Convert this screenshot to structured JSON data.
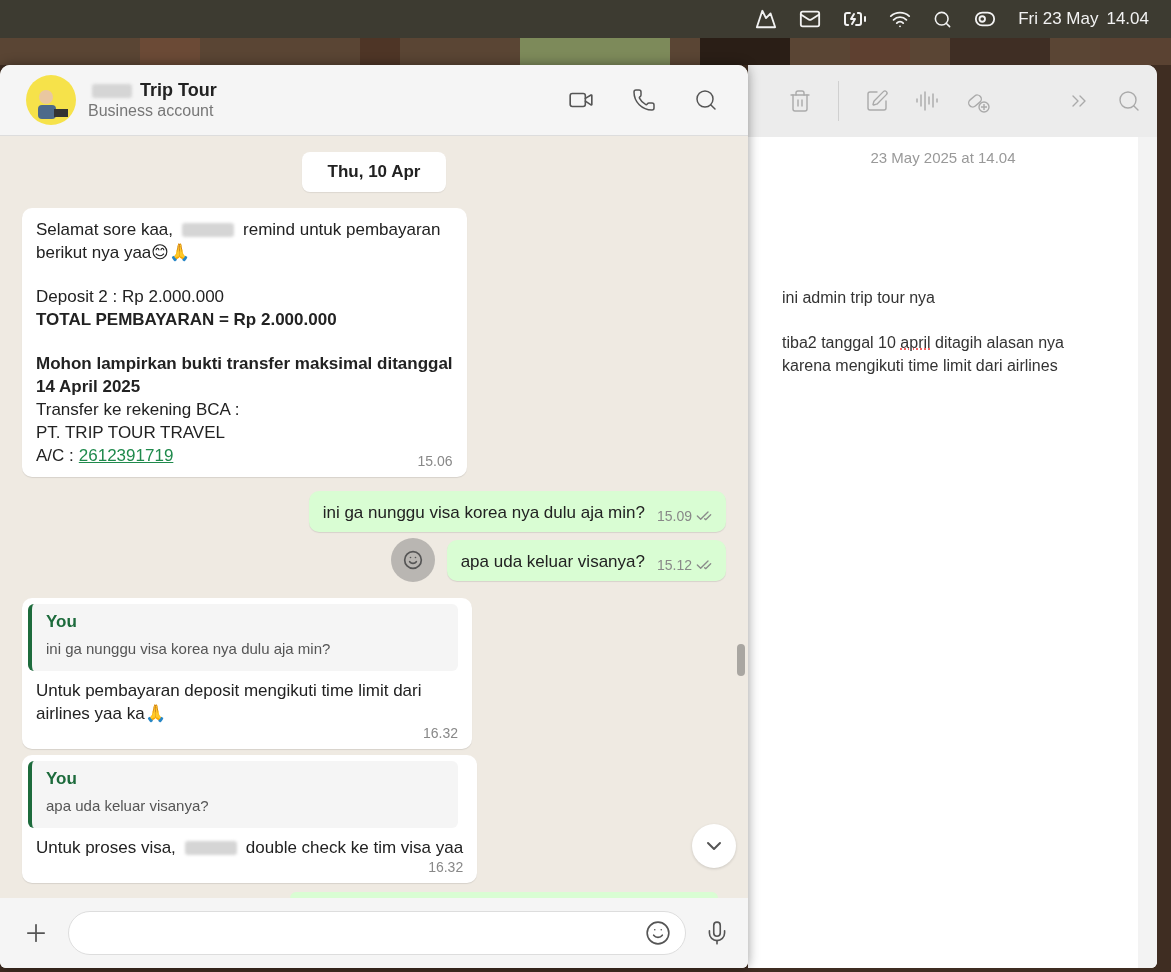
{
  "menu_bar": {
    "date": "Fri 23 May",
    "time": "14.04"
  },
  "chat": {
    "header": {
      "name": "Trip Tour",
      "name_redacted_prefix": true,
      "subtitle": "Business account"
    },
    "date_divider": "Thu, 10 Apr",
    "messages": [
      {
        "outgoing": false,
        "kind": "plain",
        "time": "15.06",
        "paragraphs": [
          [
            {
              "bold": false,
              "parts": [
                {
                  "kind": "text",
                  "text": "Selamat sore kaa,"
                },
                {
                  "kind": "redacted"
                },
                {
                  "kind": "text",
                  "text": "remind untuk pembayaran"
                }
              ]
            },
            {
              "bold": false,
              "parts": [
                {
                  "kind": "text",
                  "text": "berikut nya yaa😊🙏"
                }
              ]
            }
          ],
          [
            {
              "bold": false,
              "parts": [
                {
                  "kind": "text",
                  "text": "Deposit 2 : Rp 2.000.000"
                }
              ]
            },
            {
              "bold": true,
              "parts": [
                {
                  "kind": "text",
                  "text": "TOTAL PEMBAYARAN = Rp 2.000.000"
                }
              ]
            }
          ],
          [
            {
              "bold": true,
              "parts": [
                {
                  "kind": "text",
                  "text": "Mohon lampirkan bukti transfer maksimal ditanggal"
                }
              ]
            },
            {
              "bold": true,
              "parts": [
                {
                  "kind": "text",
                  "text": "14 April 2025"
                }
              ]
            },
            {
              "bold": false,
              "parts": [
                {
                  "kind": "text",
                  "text": "Transfer ke rekening BCA :"
                }
              ]
            },
            {
              "bold": false,
              "parts": [
                {
                  "kind": "text",
                  "text": "PT. TRIP TOUR TRAVEL"
                }
              ]
            },
            {
              "bold": false,
              "parts": [
                {
                  "kind": "text",
                  "text": "A/C :"
                },
                {
                  "kind": "link",
                  "text": "2612391719"
                }
              ]
            }
          ]
        ]
      },
      {
        "outgoing": true,
        "kind": "plain",
        "time": "15.09",
        "read": false,
        "reaction_button": false,
        "paragraphs": [
          [
            {
              "bold": false,
              "parts": [
                {
                  "kind": "text",
                  "text": "ini ga nunggu visa korea nya dulu aja min?"
                }
              ]
            }
          ]
        ]
      },
      {
        "outgoing": true,
        "kind": "plain",
        "time": "15.12",
        "read": false,
        "reaction_button": true,
        "paragraphs": [
          [
            {
              "bold": false,
              "parts": [
                {
                  "kind": "text",
                  "text": "apa uda keluar visanya?"
                }
              ]
            }
          ]
        ]
      },
      {
        "outgoing": false,
        "kind": "reply",
        "time": "16.32",
        "quote": {
          "author": "You",
          "text": "ini ga nunggu visa korea nya dulu aja min?"
        },
        "paragraphs": [
          [
            {
              "bold": false,
              "parts": [
                {
                  "kind": "text",
                  "text": "Untuk pembayaran deposit mengikuti time limit dari"
                }
              ]
            },
            {
              "bold": false,
              "parts": [
                {
                  "kind": "text",
                  "text": "airlines yaa ka🙏"
                }
              ]
            }
          ]
        ]
      },
      {
        "outgoing": false,
        "kind": "reply",
        "time": "16.32",
        "quote": {
          "author": "You",
          "text": "apa uda keluar visanya?"
        },
        "paragraphs": [
          [
            {
              "bold": false,
              "parts": [
                {
                  "kind": "text",
                  "text": "Untuk proses visa,"
                },
                {
                  "kind": "redacted"
                },
                {
                  "kind": "text",
                  "text": "double check ke tim visa yaa"
                }
              ]
            }
          ]
        ]
      }
    ]
  },
  "note": {
    "timestamp": "23 May 2025 at 14.04",
    "paragraphs": [
      [
        {
          "text": "ini admin trip tour nya",
          "misspelled": false
        }
      ],
      [
        {
          "text": "tiba2 tanggal 10 ",
          "misspelled": false
        },
        {
          "text": "april",
          "misspelled": true
        },
        {
          "text": " ditagih alasan nya karena mengikuti time limit dari airlines",
          "misspelled": false
        }
      ]
    ]
  }
}
